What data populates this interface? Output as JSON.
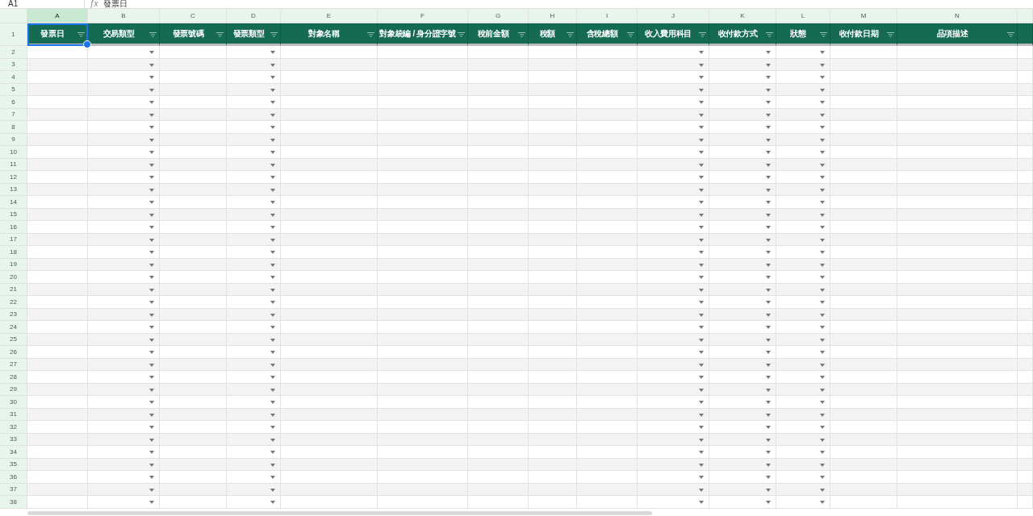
{
  "formula_bar": {
    "cell_ref": "A1",
    "function_label": "ƒx",
    "formula": "發票日"
  },
  "columns": [
    {
      "letter": "A",
      "header": "發票日",
      "selected": true,
      "dropdown": false
    },
    {
      "letter": "B",
      "header": "交易類型",
      "selected": false,
      "dropdown": true
    },
    {
      "letter": "C",
      "header": "發票號碼",
      "selected": false,
      "dropdown": false
    },
    {
      "letter": "D",
      "header": "發票類型",
      "selected": false,
      "dropdown": true
    },
    {
      "letter": "E",
      "header": "對象名稱",
      "selected": false,
      "dropdown": false
    },
    {
      "letter": "F",
      "header": "對象統編 / 身分證字號",
      "selected": false,
      "dropdown": false
    },
    {
      "letter": "G",
      "header": "稅前金額",
      "selected": false,
      "dropdown": false
    },
    {
      "letter": "H",
      "header": "稅額",
      "selected": false,
      "dropdown": false
    },
    {
      "letter": "I",
      "header": "含稅總額",
      "selected": false,
      "dropdown": false
    },
    {
      "letter": "J",
      "header": "收入費用科目",
      "selected": false,
      "dropdown": true
    },
    {
      "letter": "K",
      "header": "收付款方式",
      "selected": false,
      "dropdown": true
    },
    {
      "letter": "L",
      "header": "狀態",
      "selected": false,
      "dropdown": true
    },
    {
      "letter": "M",
      "header": "收付款日期",
      "selected": false,
      "dropdown": false
    },
    {
      "letter": "N",
      "header": "品項描述",
      "selected": false,
      "dropdown": false
    }
  ],
  "header_row_number": "1",
  "row_numbers": [
    "2",
    "3",
    "4",
    "5",
    "6",
    "7",
    "8",
    "9",
    "10",
    "11",
    "12",
    "13",
    "14",
    "15",
    "16",
    "17",
    "18",
    "19",
    "20",
    "21",
    "22",
    "23",
    "24",
    "25",
    "26",
    "27",
    "28",
    "29",
    "30",
    "31",
    "32",
    "33",
    "34",
    "35",
    "36",
    "37",
    "38"
  ]
}
